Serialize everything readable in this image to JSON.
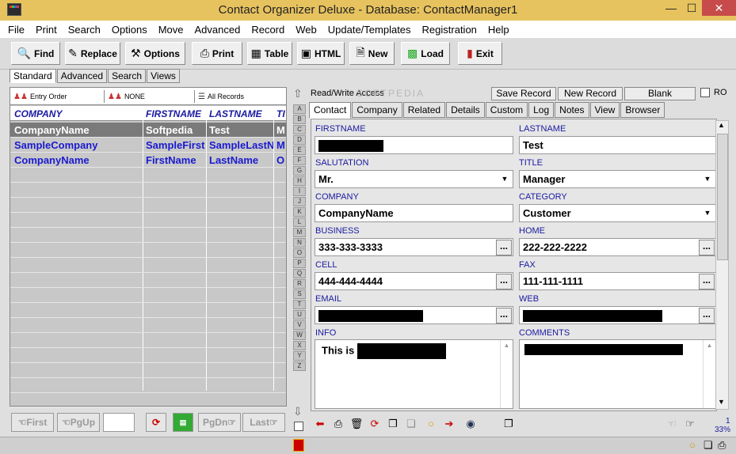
{
  "window": {
    "title": "Contact Organizer Deluxe - Database: ContactManager1",
    "min": "—",
    "max": "☐",
    "close": "✕"
  },
  "menu": [
    "File",
    "Print",
    "Search",
    "Options",
    "Move",
    "Advanced",
    "Record",
    "Web",
    "Update/Templates",
    "Registration",
    "Help"
  ],
  "toolbar": {
    "find": "Find",
    "replace": "Replace",
    "options": "Options",
    "print": "Print",
    "table": "Table",
    "html": "HTML",
    "new": "New",
    "load": "Load",
    "exit": "Exit"
  },
  "left_tabs": [
    "Standard",
    "Advanced",
    "Search",
    "Views"
  ],
  "sort": {
    "order": "Entry Order",
    "filter": "NONE",
    "records": "All Records"
  },
  "grid": {
    "headers": [
      "COMPANY",
      "FIRSTNAME",
      "LASTNAME",
      "TI"
    ],
    "rows": [
      [
        "CompanyName",
        "Softpedia",
        "Test",
        "M"
      ],
      [
        "SampleCompany",
        "SampleFirst",
        "SampleLastN",
        "M"
      ],
      [
        "CompanyName",
        "FirstName",
        "LastName",
        "O"
      ]
    ]
  },
  "nav": {
    "first": "First",
    "pgup": "PgUp",
    "pgdn": "PgDn",
    "last": "Last"
  },
  "alphabet": [
    "A",
    "B",
    "C",
    "D",
    "E",
    "F",
    "G",
    "H",
    "I",
    "J",
    "K",
    "L",
    "M",
    "N",
    "O",
    "P",
    "Q",
    "R",
    "S",
    "T",
    "U",
    "V",
    "W",
    "X",
    "Y",
    "Z"
  ],
  "record_bar": {
    "access": "Read/Write Access",
    "save": "Save Record",
    "new": "New Record",
    "blank": "Blank",
    "ro": "RO"
  },
  "right_tabs": [
    "Contact",
    "Company",
    "Related",
    "Details",
    "Custom",
    "Log",
    "Notes",
    "View",
    "Browser"
  ],
  "form": {
    "firstname_label": "FIRSTNAME",
    "firstname": "",
    "lastname_label": "LASTNAME",
    "lastname": "Test",
    "salutation_label": "SALUTATION",
    "salutation": "Mr.",
    "title_label": "TITLE",
    "title": "Manager",
    "company_label": "COMPANY",
    "company": "CompanyName",
    "category_label": "CATEGORY",
    "category": "Customer",
    "business_label": "BUSINESS",
    "business": "333-333-3333",
    "home_label": "HOME",
    "home": "222-222-2222",
    "cell_label": "CELL",
    "cell": "444-444-4444",
    "fax_label": "FAX",
    "fax": "111-111-1111",
    "email_label": "EMAIL",
    "email": "",
    "web_label": "WEB",
    "web": "",
    "info_label": "INFO",
    "info": "This is",
    "comments_label": "COMMENTS",
    "comments": ""
  },
  "ellipsis": "...",
  "status": {
    "count": "1",
    "zoom": "33%"
  },
  "watermark": "SOFTPEDIA"
}
